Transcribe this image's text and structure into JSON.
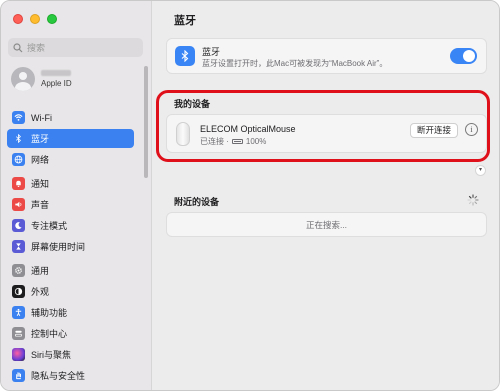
{
  "sidebar": {
    "search_placeholder": "搜索",
    "account_sub": "Apple ID",
    "items": [
      {
        "label": "Wi-Fi",
        "icon": "wifi-icon",
        "color": "#3b82f0"
      },
      {
        "label": "蓝牙",
        "icon": "bluetooth-icon",
        "color": "#3b82f0",
        "active": true
      },
      {
        "label": "网络",
        "icon": "globe-icon",
        "color": "#3b82f0"
      },
      {
        "label": "通知",
        "icon": "bell-icon",
        "color": "#ec4a47"
      },
      {
        "label": "声音",
        "icon": "speaker-icon",
        "color": "#ec4a47"
      },
      {
        "label": "专注模式",
        "icon": "moon-icon",
        "color": "#5b5bd6"
      },
      {
        "label": "屏幕使用时间",
        "icon": "hourglass-icon",
        "color": "#5b5bd6"
      },
      {
        "label": "通用",
        "icon": "gear-icon",
        "color": "#8e8e93"
      },
      {
        "label": "外观",
        "icon": "appearance-icon",
        "color": "#1d1d1f"
      },
      {
        "label": "辅助功能",
        "icon": "accessibility-icon",
        "color": "#3b82f0"
      },
      {
        "label": "控制中心",
        "icon": "control-center-icon",
        "color": "#8e8e93"
      },
      {
        "label": "Siri与聚焦",
        "icon": "siri-icon",
        "color": "#6a3fd6"
      },
      {
        "label": "隐私与安全性",
        "icon": "hand-icon",
        "color": "#3b82f0"
      }
    ]
  },
  "main": {
    "title": "蓝牙",
    "bluetooth": {
      "title": "蓝牙",
      "description": "蓝牙设置打开时，此Mac可被发现为“MacBook Air”。",
      "enabled": true
    },
    "my_devices": {
      "label": "我的设备",
      "device_name": "ELECOM OpticalMouse",
      "status_connected": "已连接 ·",
      "battery": "100%",
      "disconnect_label": "断开连接",
      "info_label": "i"
    },
    "nearby": {
      "label": "附近的设备",
      "searching": "正在搜索..."
    }
  },
  "colors": {
    "accent": "#3a85f5",
    "highlight": "#e0101a"
  }
}
